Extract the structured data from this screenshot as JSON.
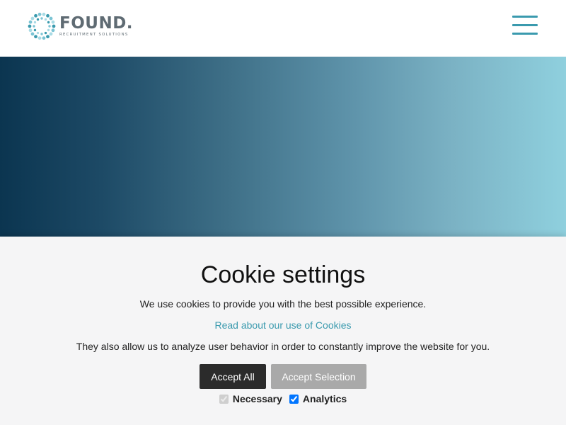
{
  "header": {
    "logo": {
      "name": "FOUND.",
      "tagline": "RECRUITMENT SOLUTIONS",
      "icon": "dotted-circle-logo-icon",
      "colors": {
        "text": "#5f6b73",
        "dots": [
          "#3a9aae",
          "#7bc4d4",
          "#a9dbe5"
        ]
      }
    },
    "menu": {
      "icon": "hamburger-menu-icon",
      "color": "#3a9aae"
    }
  },
  "hero": {
    "gradient": [
      "#0b3550",
      "#8fd0de"
    ]
  },
  "cookie": {
    "title": "Cookie settings",
    "line1": "We use cookies to provide you with the best possible experience.",
    "link": "Read about our use of Cookies",
    "line2": "They also allow us to analyze user behavior in order to constantly improve the website for you.",
    "accept_all": "Accept All",
    "accept_selection": "Accept Selection",
    "options": [
      {
        "label": "Necessary",
        "checked": true,
        "disabled": true
      },
      {
        "label": "Analytics",
        "checked": true,
        "disabled": false
      }
    ],
    "colors": {
      "panel_bg": "#f5f5f6",
      "link": "#3a9aae",
      "accept_all_bg": "#2b2b2b",
      "accept_selection_bg": "#a9a9a9"
    }
  }
}
